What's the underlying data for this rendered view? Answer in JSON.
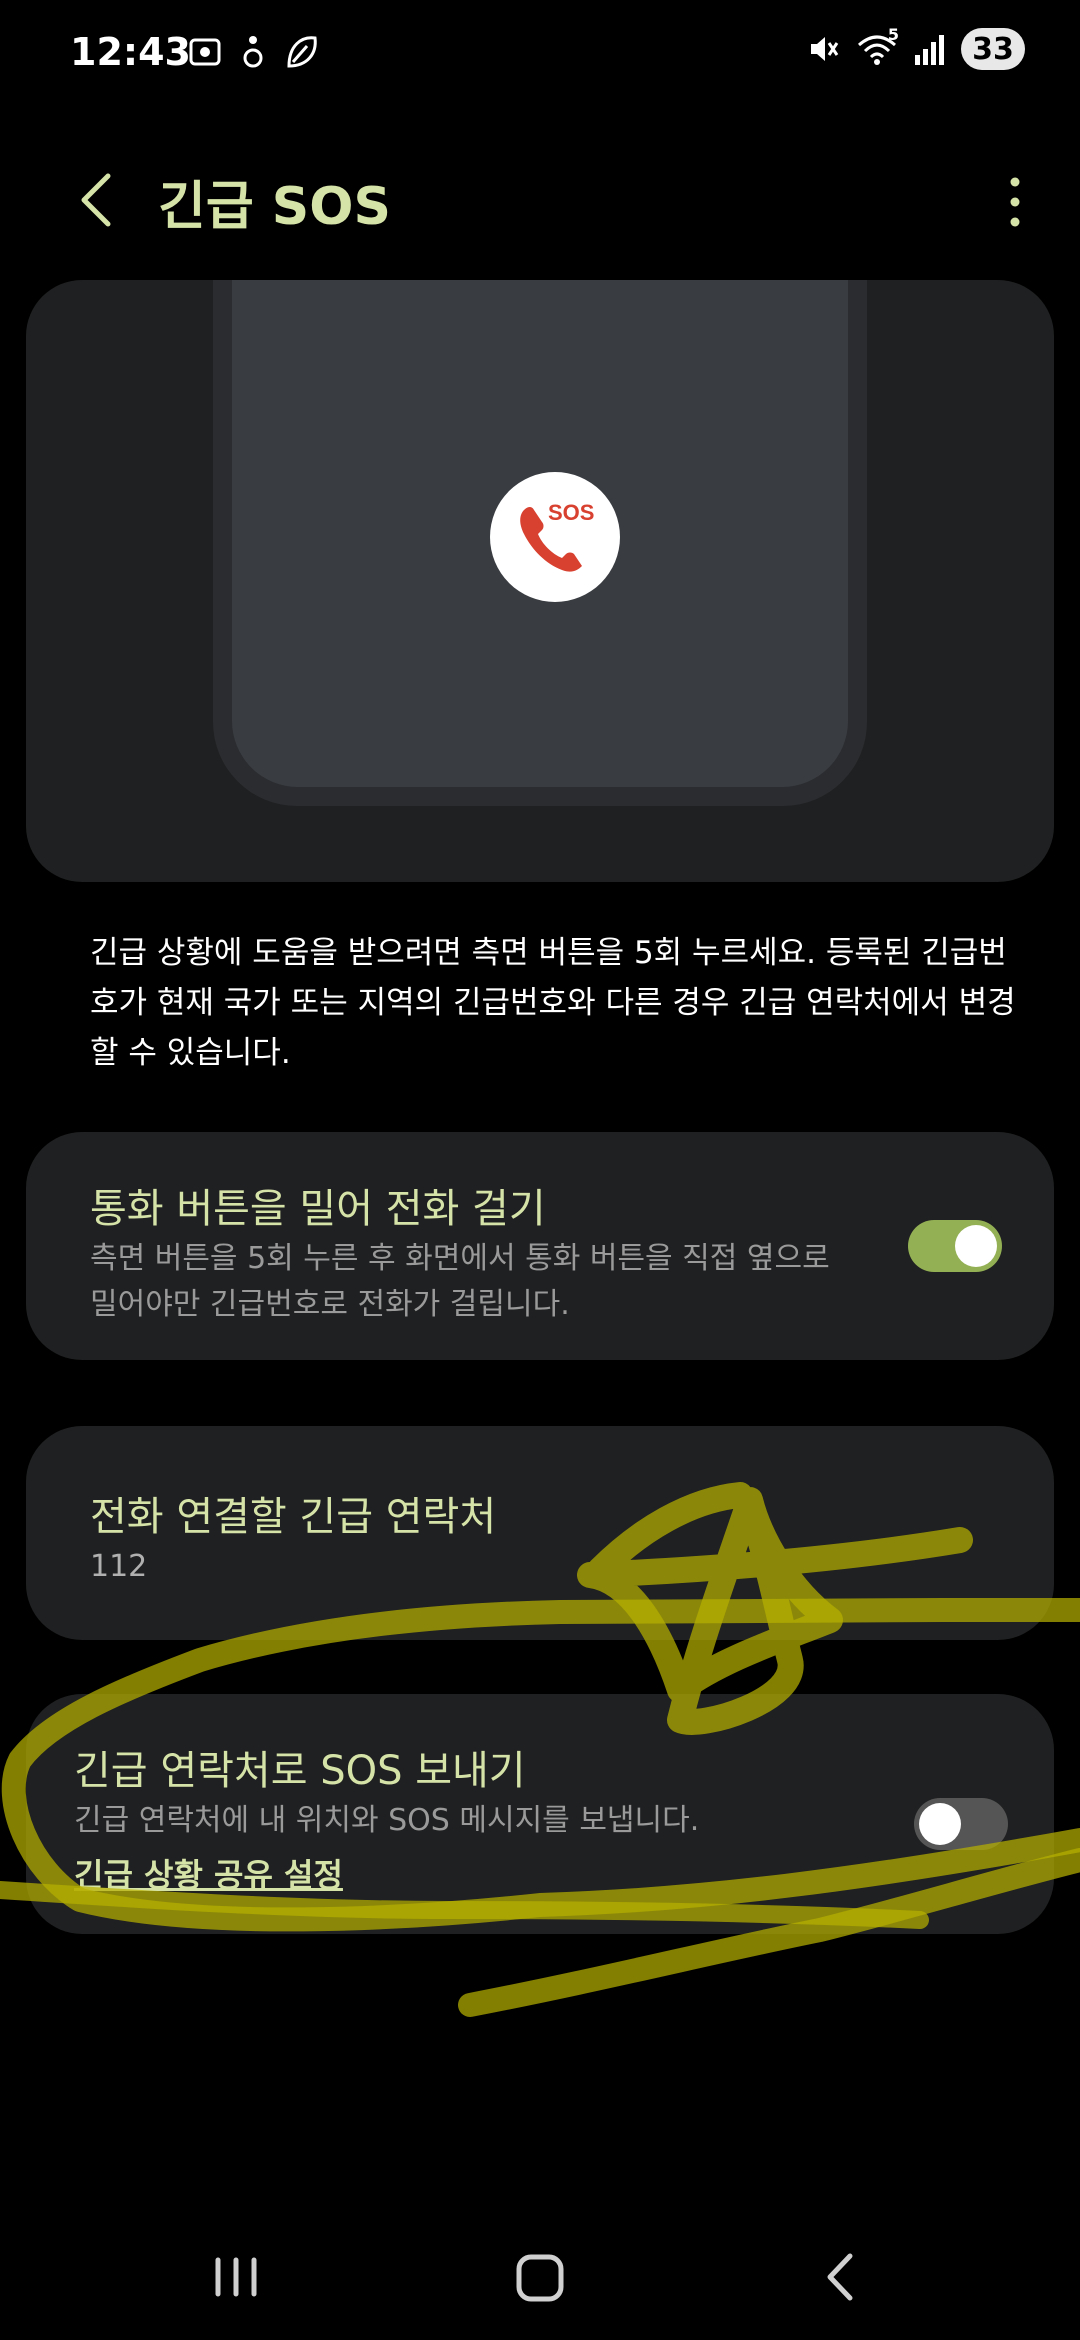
{
  "status_bar": {
    "time": "12:43",
    "battery": "33",
    "network": "5"
  },
  "header": {
    "title": "긴급 SOS"
  },
  "hero": {
    "sos_label": "SOS"
  },
  "description": "긴급 상황에 도움을 받으려면 측면 버튼을 5회 누르세요. 등록된 긴급번호가 현재 국가 또는 지역의 긴급번호와 다른 경우 긴급 연락처에서 변경할 수 있습니다.",
  "settings": {
    "swipe_to_call": {
      "title": "통화 버튼을 밀어 전화 걸기",
      "subtitle": "측면 버튼을 5회 누른 후 화면에서 통화 버튼을 직접 옆으로 밀어야만 긴급번호로 전화가 걸립니다.",
      "enabled": true
    },
    "emergency_contact": {
      "title": "전화 연결할 긴급 연락처",
      "value": "112"
    },
    "send_sos": {
      "title": "긴급 연락처로 SOS 보내기",
      "subtitle": "긴급 연락처에 내 위치와 SOS 메시지를 보냅니다.",
      "link": "긴급 상황 공유 설정",
      "enabled": false
    }
  },
  "colors": {
    "accent": "#d6e3a8",
    "toggle_on": "#93b054",
    "card_bg": "#1f2021",
    "annotation": "#b5b000"
  }
}
